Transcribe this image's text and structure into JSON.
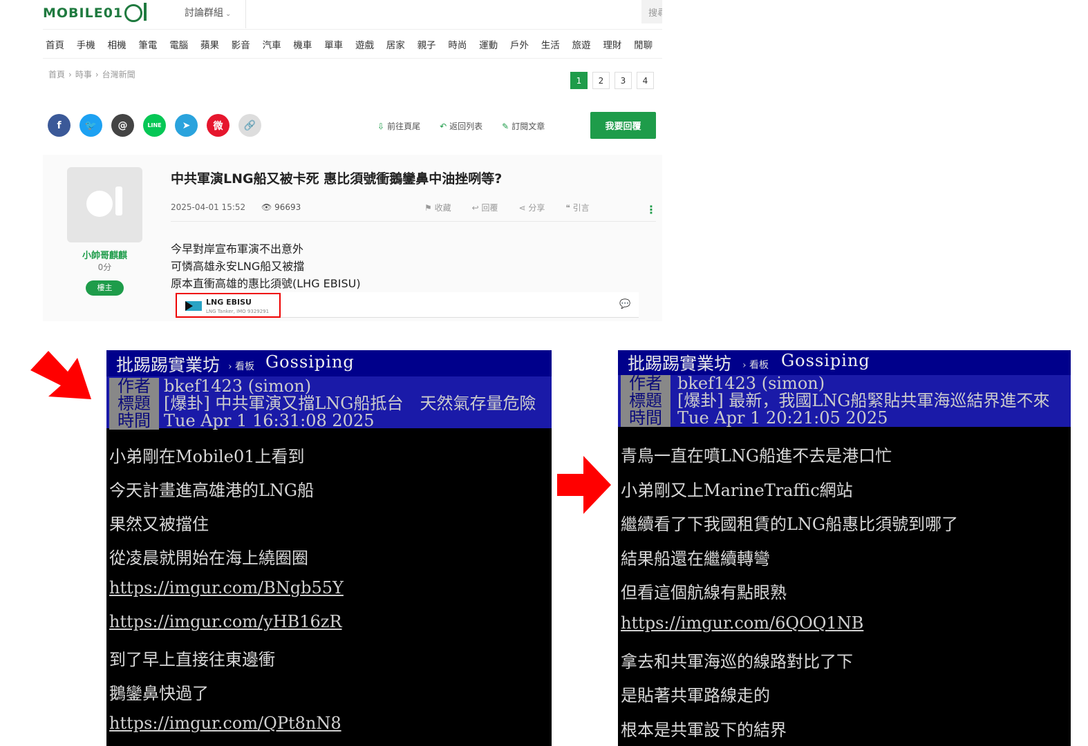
{
  "mobile01": {
    "logo": "MOBILE01",
    "forum_groups": "討論群組",
    "search_placeholder": "搜尋",
    "nav": [
      "首頁",
      "手機",
      "相機",
      "筆電",
      "電腦",
      "蘋果",
      "影音",
      "汽車",
      "機車",
      "單車",
      "遊戲",
      "居家",
      "親子",
      "時尚",
      "運動",
      "戶外",
      "生活",
      "旅遊",
      "理財",
      "閒聊"
    ],
    "breadcrumb": [
      "首頁",
      "時事",
      "台灣新聞"
    ],
    "pages": [
      "1",
      "2",
      "3",
      "4"
    ],
    "active_page": "1",
    "share_icons": [
      {
        "name": "facebook-icon",
        "glyph": "f",
        "color": "#3b5998"
      },
      {
        "name": "twitter-icon",
        "glyph": "🐦",
        "color": "#1da1f2"
      },
      {
        "name": "threads-icon",
        "glyph": "@",
        "color": "#444444"
      },
      {
        "name": "line-icon",
        "glyph": "LINE",
        "color": "#06c755"
      },
      {
        "name": "telegram-icon",
        "glyph": "➤",
        "color": "#2aa3dd"
      },
      {
        "name": "weibo-icon",
        "glyph": "微",
        "color": "#e6162d"
      },
      {
        "name": "link-icon",
        "glyph": "🔗",
        "color": "#dddddd"
      }
    ],
    "actions": {
      "last_page": "前往頁尾",
      "back_to_list": "返回列表",
      "subscribe": "訂閱文章"
    },
    "reply_button": "我要回覆",
    "author": {
      "name": "小帥哥麒麒",
      "score": "0分",
      "badge": "樓主"
    },
    "post": {
      "title": "中共軍演LNG船又被卡死 惠比須號衝鵝鑾鼻中油挫咧等?",
      "datetime": "2025-04-01 15:52",
      "views": "96693",
      "tools": {
        "save": "收藏",
        "reply": "回覆",
        "share": "分享",
        "quote": "引言"
      },
      "body": [
        "今早對岸宣布軍演不出意外",
        "可憐高雄永安LNG船又被擋",
        "原本直衝高雄的惠比須號(LHG EBISU)"
      ],
      "embed": {
        "name": "LNG EBISU",
        "sub": "LNG Tanker, IMO 9329291"
      }
    }
  },
  "ptt_left": {
    "board_name": "批踢踢實業坊",
    "crumb": "›  看板",
    "board": "Gossiping",
    "header": [
      {
        "label": "作者",
        "value": "bkef1423 (simon)"
      },
      {
        "label": "標題",
        "value": "[爆卦] 中共軍演又擋LNG船抵台　天然氣存量危險"
      },
      {
        "label": "時間",
        "value": "Tue Apr  1 16:31:08 2025"
      }
    ],
    "lines": [
      {
        "text": "小弟剛在Mobile01上看到",
        "link": false
      },
      {
        "text": "今天計畫進高雄港的LNG船",
        "link": false
      },
      {
        "text": "果然又被擋住",
        "link": false
      },
      {
        "text": "從凌晨就開始在海上繞圈圈",
        "link": false
      },
      {
        "text": "https://imgur.com/BNgb55Y",
        "link": true
      },
      {
        "text": "https://imgur.com/yHB16zR",
        "link": true
      },
      {
        "text": "到了早上直接往東邊衝",
        "link": false
      },
      {
        "text": "鵝鑾鼻快過了",
        "link": false
      },
      {
        "text": "https://imgur.com/QPt8nN8",
        "link": true
      }
    ]
  },
  "ptt_right": {
    "board_name": "批踢踢實業坊",
    "crumb": "›  看板",
    "board": "Gossiping",
    "header": [
      {
        "label": "作者",
        "value": "bkef1423 (simon)"
      },
      {
        "label": "標題",
        "value": "[爆卦] 最新，我國LNG船緊貼共軍海巡結界進不來"
      },
      {
        "label": "時間",
        "value": "Tue Apr  1 20:21:05 2025"
      }
    ],
    "lines": [
      {
        "text": "青鳥一直在噴LNG船進不去是港口忙",
        "link": false
      },
      {
        "text": "小弟剛又上MarineTraffic網站",
        "link": false
      },
      {
        "text": "繼續看了下我國租賃的LNG船惠比須號到哪了",
        "link": false
      },
      {
        "text": "結果船還在繼續轉彎",
        "link": false
      },
      {
        "text": "但看這個航線有點眼熟",
        "link": false
      },
      {
        "text": "https://imgur.com/6QOQ1NB",
        "link": true
      },
      {
        "text": "拿去和共軍海巡的線路對比了下",
        "link": false
      },
      {
        "text": "是貼著共軍路線走的",
        "link": false
      },
      {
        "text": "根本是共軍設下的結界",
        "link": false
      }
    ]
  },
  "colors": {
    "arrow": "#ff0000",
    "ptt_bar": "#00008b",
    "mobile01_green": "#1e9c4a"
  }
}
